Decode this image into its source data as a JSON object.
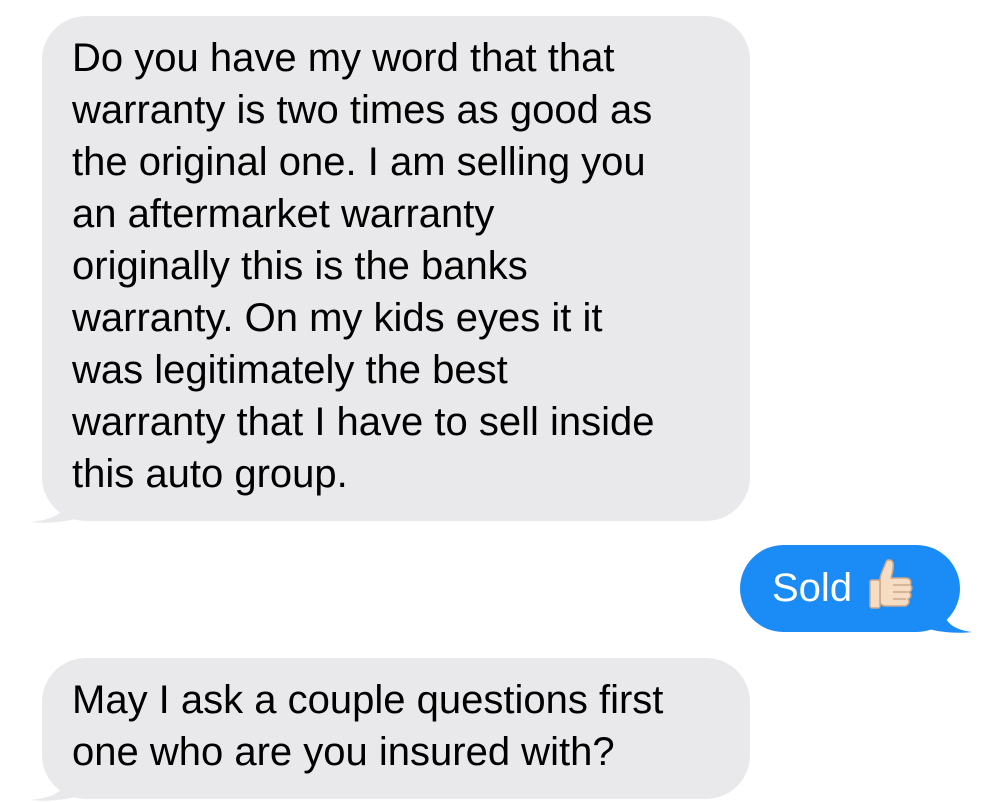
{
  "conversation": {
    "messages": [
      {
        "direction": "incoming",
        "text": "Do you have my word that that\nwarranty is two times as good as\nthe original one. I am selling you\nan aftermarket warranty\noriginally this is the banks\nwarranty. On my kids eyes it it\nwas legitimately the best\nwarranty that I have to sell inside\nthis auto group."
      },
      {
        "direction": "outgoing",
        "text": "Sold",
        "emoji": "thumbs-up-light-skin-tone"
      },
      {
        "direction": "incoming",
        "text": "May I ask a couple questions first\none who are you insured with?"
      }
    ]
  },
  "colors": {
    "incoming_bubble": "#e9e9eb",
    "outgoing_bubble": "#1b8cf6",
    "incoming_text": "#000000",
    "outgoing_text": "#ffffff",
    "background": "#ffffff"
  }
}
